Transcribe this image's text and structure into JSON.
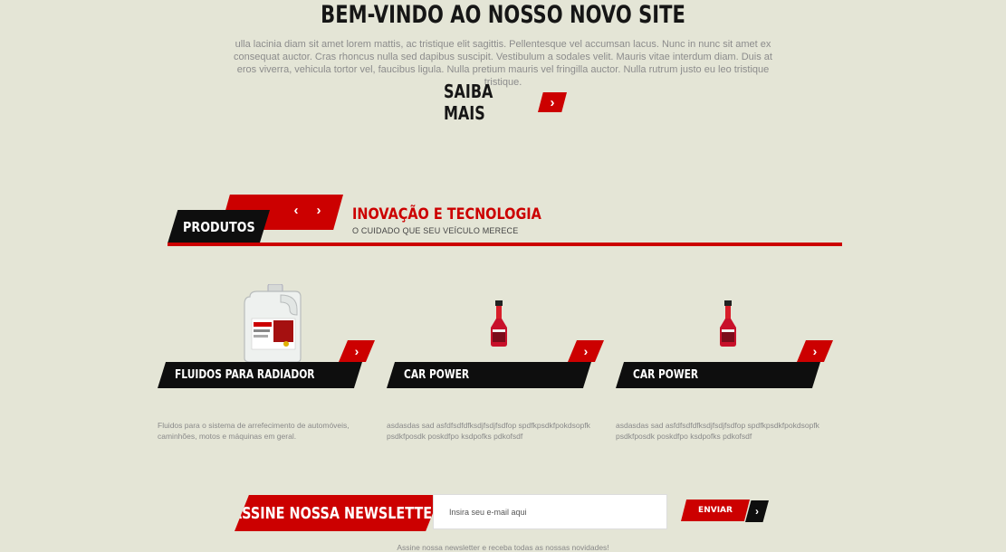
{
  "hero": {
    "title": "BEM-VINDO AO NOSSO NOVO SITE",
    "text": "ulla lacinia diam sit amet lorem mattis, ac tristique elit sagittis. Pellentesque vel accumsan lacus. Nunc in nunc sit amet ex consequat auctor. Cras rhoncus nulla sed dapibus suscipit. Vestibulum a sodales velit. Mauris vitae interdum diam. Duis at eros viverra, vehicula tortor vel, faucibus ligula. Nulla pretium mauris vel fringilla auctor. Nulla rutrum justo eu leo tristique tristique.",
    "button_label": "SAIBA MAIS",
    "button_icon": "chevron-right-icon"
  },
  "products_section": {
    "tag": "PRODUTOS",
    "title": "INOVAÇÃO E TECNOLOGIA",
    "subtitle": "O CUIDADO QUE SEU VEÍCULO MERECE",
    "prev_icon": "‹",
    "next_icon": "›",
    "items": [
      {
        "name": "FLUIDOS PARA RADIADOR",
        "image": "coolant-jug",
        "description": "Fluidos para o sistema de arrefecimento de automóveis, caminhões, motos e máquinas em geral."
      },
      {
        "name": "CAR POWER",
        "image": "red-bottle",
        "description": "asdasdas sad asfdfsdfdfksdjfsdjfsdfop spdfkpsdkfpokdsopfk psdkfposdk poskdfpo ksdpofks pdkofsdf"
      },
      {
        "name": "CAR POWER",
        "image": "red-bottle",
        "description": "asdasdas sad asfdfsdfdfksdjfsdjfsdfop spdfkpsdkfpokdsopfk psdkfposdk poskdfpo ksdpofks pdkofsdf"
      }
    ]
  },
  "newsletter": {
    "title": "ASSINE NOSSA NEWSLETTER",
    "placeholder": "Insira seu e-mail aqui",
    "submit_label": "ENVIAR",
    "note": "Assine nossa newsletter e receba todas as nossas novidades!"
  },
  "colors": {
    "accent": "#cc0000",
    "dark": "#0e0e0e",
    "background": "#e4e5d6"
  }
}
